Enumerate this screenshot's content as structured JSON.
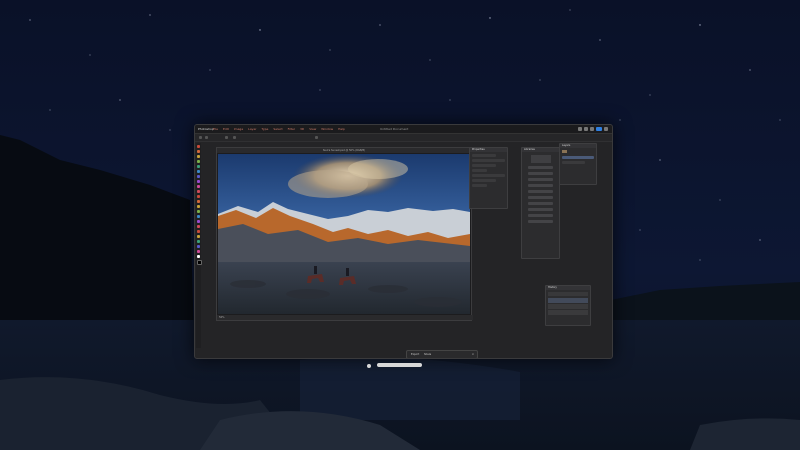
{
  "window": {
    "app_name": "Photoshop",
    "menus": [
      "File",
      "Edit",
      "Image",
      "Layer",
      "Type",
      "Select",
      "Filter",
      "3D",
      "View",
      "Window",
      "Help"
    ],
    "doc_title": "Untitled Document"
  },
  "canvas": {
    "tab_title": "Sierra Sunset.psd @ 50% (RGB/8)",
    "status": "50%"
  },
  "panels": {
    "properties_title": "Properties",
    "libraries_title": "Libraries",
    "layers_title": "Layers",
    "history_title": "History"
  },
  "bottom_bar": {
    "label_left": "Export",
    "label_right": "Share",
    "close": "×"
  },
  "colors": {
    "accent": "#2f7fe0",
    "menu_text": "#c97a6a"
  }
}
